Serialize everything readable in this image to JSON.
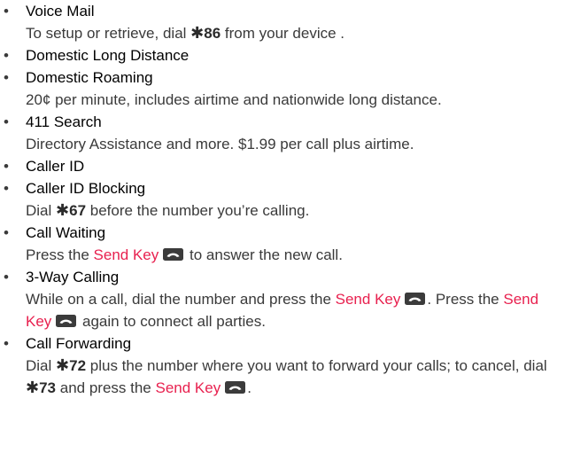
{
  "features": [
    {
      "title": "Voice Mail",
      "desc": {
        "t1": "To setup or retrieve, dial ",
        "code": "86",
        "t2": " from your device ."
      }
    },
    {
      "title": "Domestic Long Distance"
    },
    {
      "title": "Domestic Roaming",
      "desc": "20¢ per minute, includes airtime and nationwide long distance."
    },
    {
      "title": "411 Search",
      "desc": "Directory Assistance and more. $1.99 per call plus airtime."
    },
    {
      "title": "Caller ID"
    },
    {
      "title": "Caller ID Blocking",
      "desc": {
        "t1": "Dial ",
        "code": "67",
        "t2": " before the number you’re calling."
      }
    },
    {
      "title": "Call Waiting",
      "desc": {
        "t1": "Press the ",
        "key": "Send Key",
        "t2": " to answer the new call."
      }
    },
    {
      "title": "3-Way Calling",
      "desc": {
        "t1": "While on a call, dial the number and press the ",
        "key1": "Send Key",
        "t2": ". Press the ",
        "key2": "Send Key",
        "t3": " again to connect all parties."
      }
    },
    {
      "title": "Call Forwarding",
      "desc": {
        "t1": "Dial ",
        "code1": "72",
        "t2": " plus the number where you want to forward your calls; to cancel, dial ",
        "code2": "73",
        "t3": " and press the ",
        "key": "Send Key",
        "t4": "."
      }
    }
  ],
  "symbols": {
    "bullet": "•",
    "star": "✱"
  },
  "colors": {
    "text": "#3a3a3a",
    "title": "#000000",
    "key_label": "#e8214f",
    "key_icon": "#3b3b3b"
  },
  "icons": {
    "send_key": "send-key-icon",
    "star": "star-icon"
  }
}
